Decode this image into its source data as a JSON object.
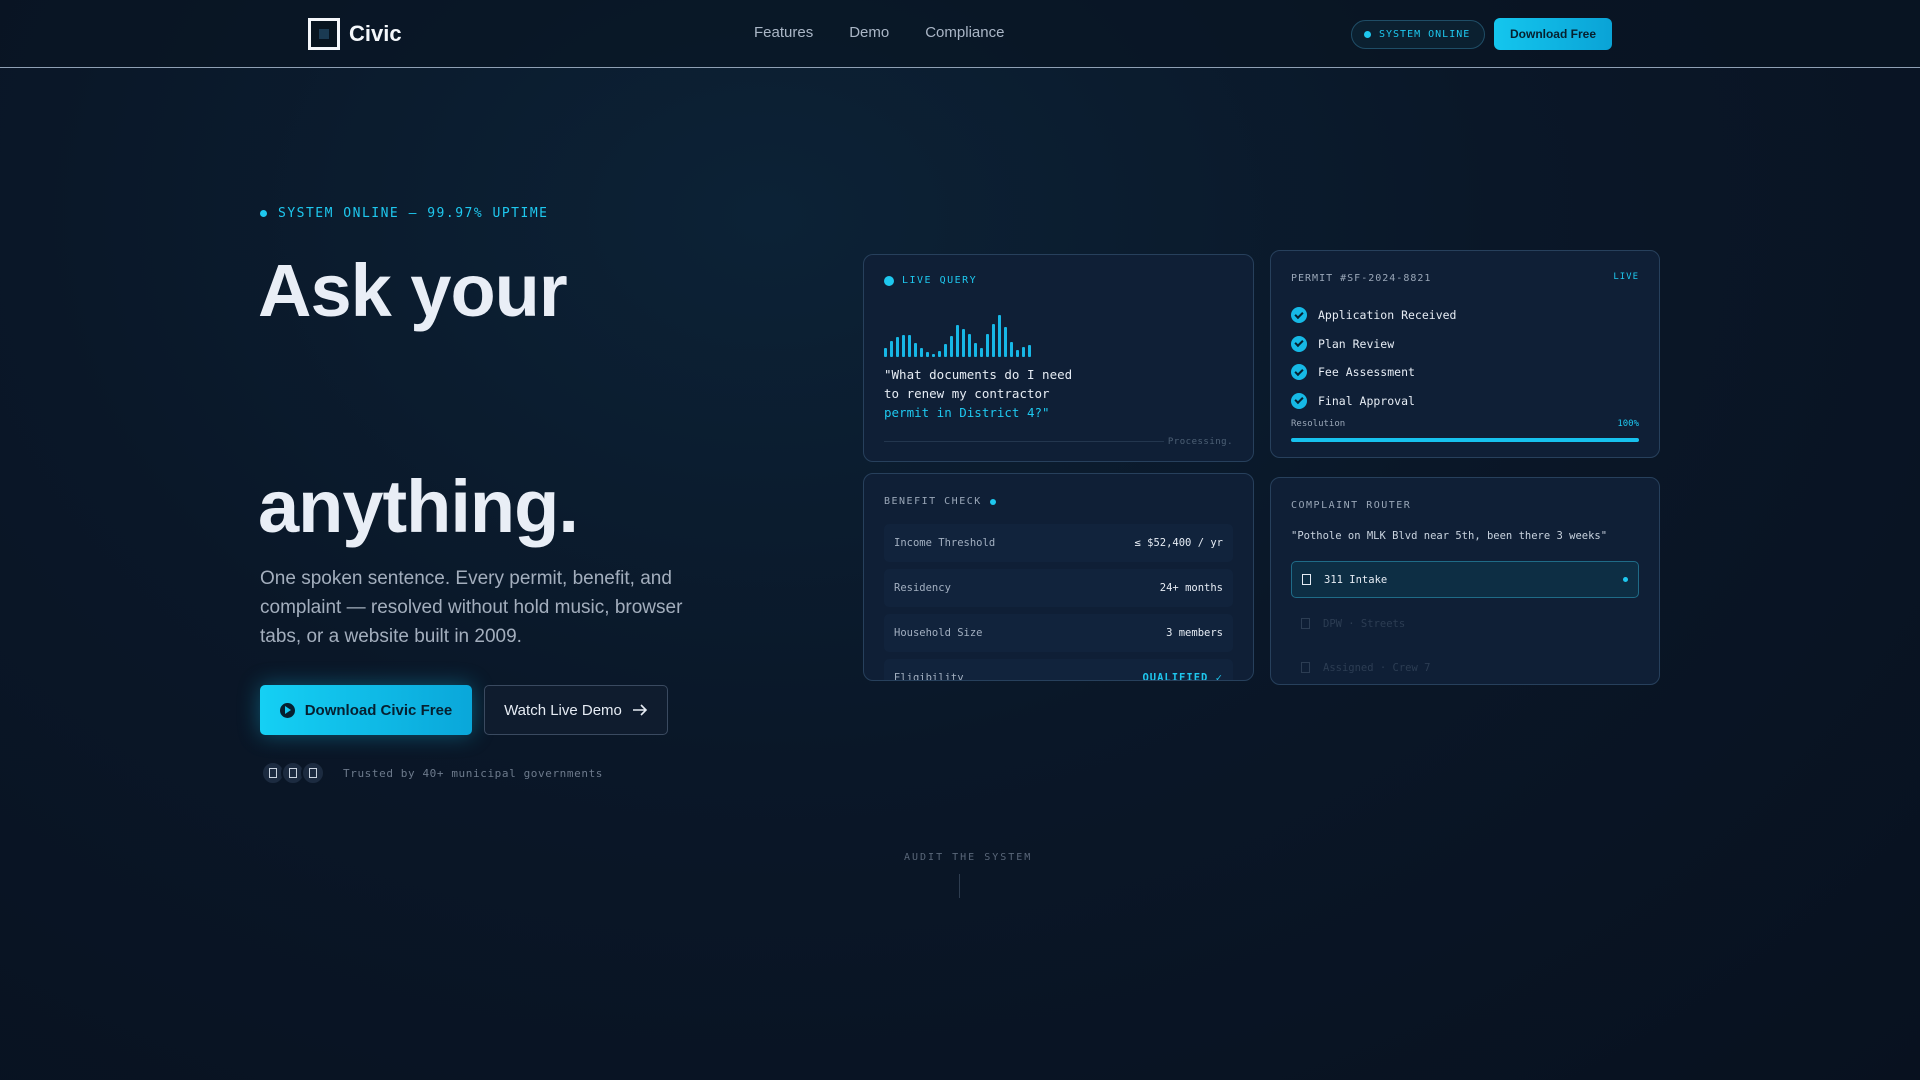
{
  "nav": {
    "logo_text": "Civic",
    "links": [
      "Features",
      "Demo",
      "Compliance"
    ],
    "status_pill": "SYSTEM ONLINE",
    "download_label": "Download Free"
  },
  "hero": {
    "status": "SYSTEM ONLINE — 99.97% UPTIME",
    "title_line1": "Ask your",
    "title_line2": "anything.",
    "subtitle": "One spoken sentence. Every permit, benefit, and complaint — resolved without hold music, browser tabs, or a website built in 2009.",
    "primary_button": "Download Civic Free",
    "secondary_button": "Watch Live Demo",
    "trust_text": "Trusted by 40+ municipal governments"
  },
  "live_query": {
    "label": "LIVE QUERY",
    "query_line1": "\"What documents do I need",
    "query_line2": "to renew my contractor",
    "query_line3": "permit in District 4?\"",
    "processing": "Processing."
  },
  "permit": {
    "id": "PERMIT #SF-2024-8821",
    "live": "LIVE",
    "steps": [
      "Application Received",
      "Plan Review",
      "Fee Assessment",
      "Final Approval"
    ],
    "resolution_label": "Resolution",
    "resolution_value": "100%",
    "resolution_fraction": 1.0
  },
  "benefit": {
    "label": "BENEFIT CHECK",
    "rows": [
      {
        "key": "Income Threshold",
        "value": "≤ $52,400 / yr"
      },
      {
        "key": "Residency",
        "value": "24+ months"
      },
      {
        "key": "Household Size",
        "value": "3 members"
      },
      {
        "key": "Eligibility",
        "value": "QUALIFIED ✓"
      }
    ]
  },
  "complaint": {
    "label": "COMPLAINT ROUTER",
    "quote": "\"Pothole on MLK Blvd near 5th, been there 3 weeks\"",
    "routes": [
      "311 Intake",
      "DPW · Streets",
      "Assigned · Crew 7"
    ]
  },
  "audit": {
    "label": "AUDIT THE SYSTEM"
  },
  "colors": {
    "accent": "#1ec8ef",
    "background": "#0a1728",
    "card": "#0f1f36"
  }
}
